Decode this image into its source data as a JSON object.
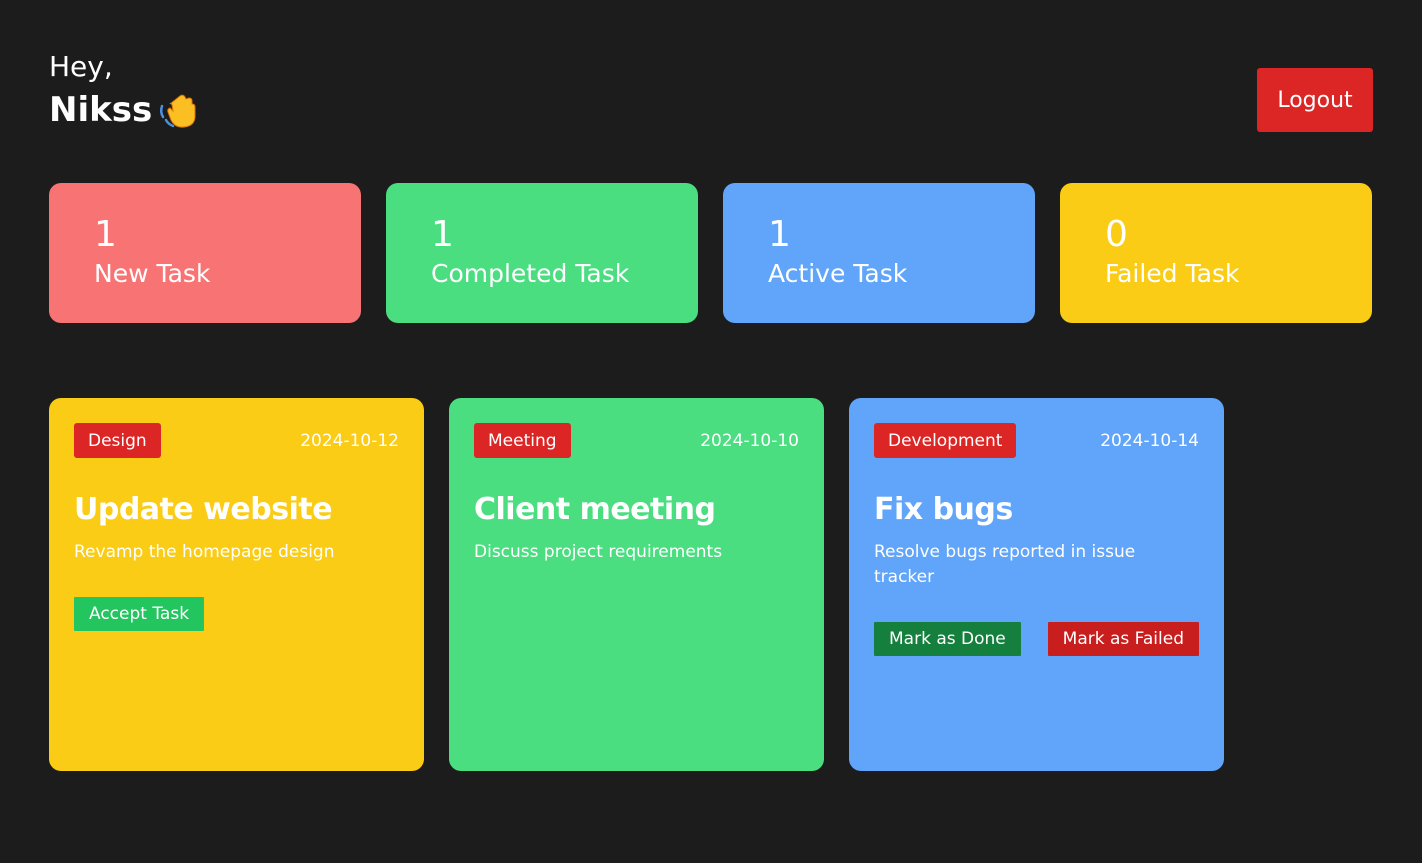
{
  "header": {
    "greeting": "Hey,",
    "name": "Nikss",
    "logout_label": "Logout"
  },
  "stats": [
    {
      "count": "1",
      "label": "New Task",
      "color": "#f87373"
    },
    {
      "count": "1",
      "label": "Completed Task",
      "color": "#4ade80"
    },
    {
      "count": "1",
      "label": "Active Task",
      "color": "#60a5fa"
    },
    {
      "count": "0",
      "label": "Failed Task",
      "color": "#facc15"
    }
  ],
  "tasks": [
    {
      "category": "Design",
      "date": "2024-10-12",
      "title": "Update website",
      "description": "Revamp the homepage design",
      "color": "#facc15",
      "actions": {
        "accept": "Accept Task"
      }
    },
    {
      "category": "Meeting",
      "date": "2024-10-10",
      "title": "Client meeting",
      "description": "Discuss project requirements",
      "color": "#4ade80"
    },
    {
      "category": "Development",
      "date": "2024-10-14",
      "title": "Fix bugs",
      "description": "Resolve bugs reported in issue tracker",
      "color": "#60a5fa",
      "actions": {
        "done": "Mark as Done",
        "failed": "Mark as Failed"
      }
    }
  ],
  "colors": {
    "background": "#1c1c1c",
    "danger": "#dc2626",
    "accept": "#22c55e",
    "done": "#15803d"
  }
}
